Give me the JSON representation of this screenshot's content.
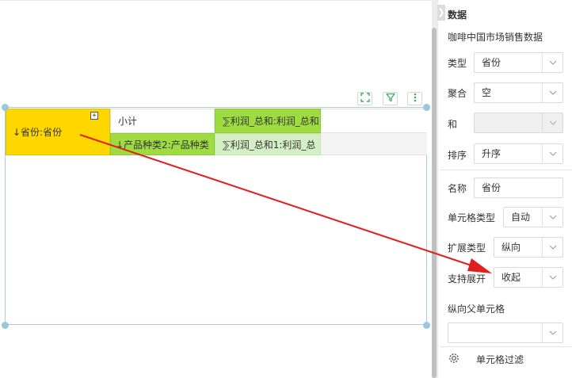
{
  "canvas": {
    "cells": {
      "province": "↓省份:省份",
      "expand_symbol": "+",
      "subtotal": "小计",
      "profit_sum": "⅀利润_总和:利润_总和",
      "product_type": "↓产品种类2:产品种类",
      "profit_sum1": "⅀利润_总和1:利润_总"
    },
    "tools": [
      "fullscreen-icon",
      "filter-icon",
      "more-vertical-icon"
    ]
  },
  "panel": {
    "title": "数据",
    "collapse_glyph": "❯",
    "dataset": "咖啡中国市场销售数据",
    "type_label": "类型",
    "type_value": "省份",
    "aggregate_label": "聚合",
    "aggregate_value": "空",
    "and_label": "和",
    "and_value": "",
    "sort_label": "排序",
    "sort_value": "升序",
    "name_label": "名称",
    "name_value": "省份",
    "cell_type_label": "单元格类型",
    "cell_type_value": "自动",
    "expand_type_label": "扩展类型",
    "expand_type_value": "纵向",
    "support_expand_label": "支持展开",
    "support_expand_value": "收起",
    "parent_cell_label": "纵向父单元格",
    "parent_cell_value": "",
    "cell_filter_label": "单元格过滤"
  },
  "colors": {
    "province_cell": "#ffd700",
    "green_cell": "#9ddb40",
    "light_green_cell": "#d4efc4",
    "selection_border": "#a9cfe0",
    "annotation_arrow": "#e01e1e"
  }
}
